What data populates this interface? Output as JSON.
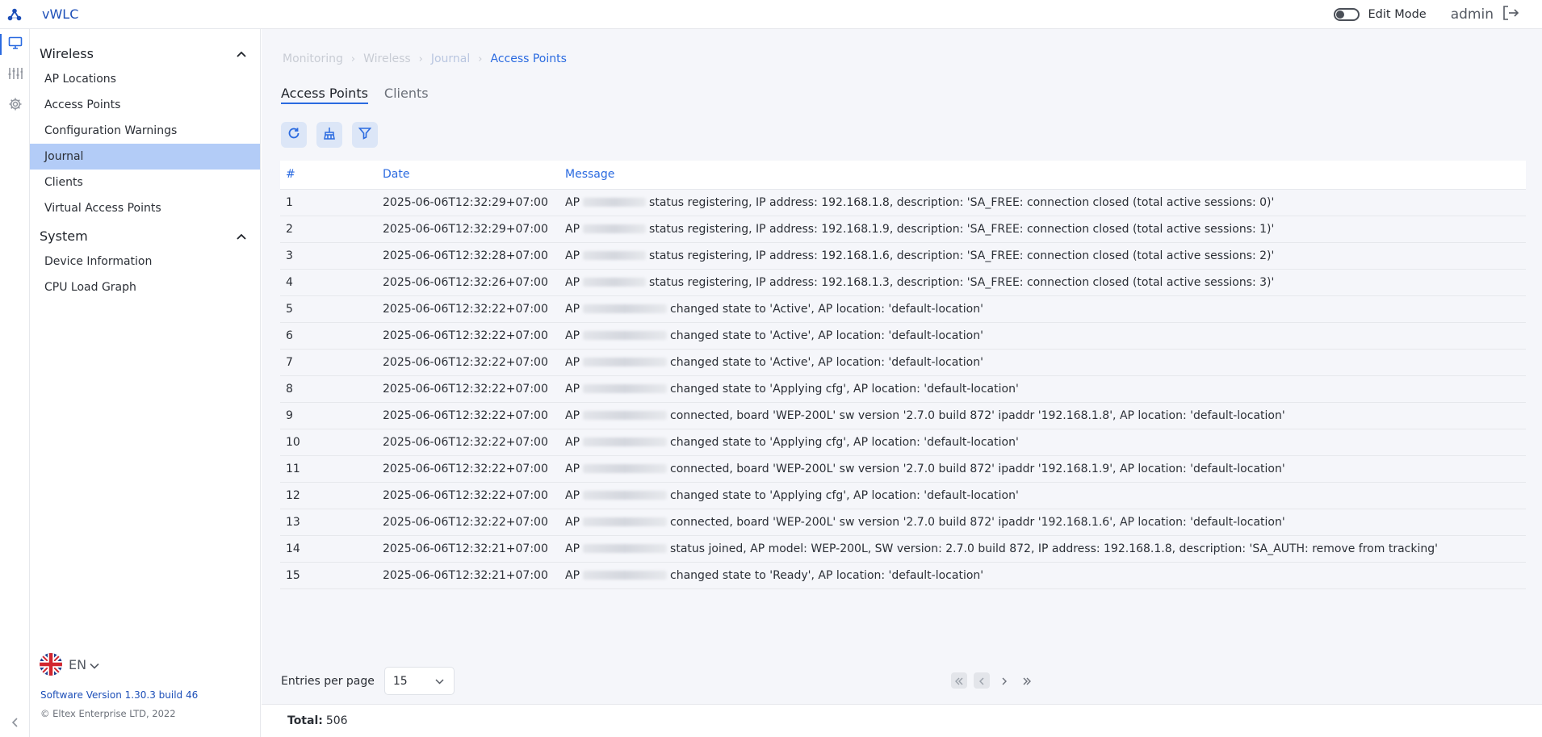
{
  "app": {
    "title": "vWLC"
  },
  "header": {
    "edit_mode_label": "Edit Mode",
    "edit_mode_on": false,
    "user": "admin"
  },
  "sidebar": {
    "sections": [
      {
        "title": "Wireless",
        "items": [
          "AP Locations",
          "Access Points",
          "Configuration Warnings",
          "Journal",
          "Clients",
          "Virtual Access Points"
        ]
      },
      {
        "title": "System",
        "items": [
          "Device Information",
          "CPU Load Graph"
        ]
      }
    ],
    "active_item": "Journal",
    "language": "EN",
    "version": "Software Version 1.30.3 build 46",
    "copyright": "© Eltex Enterprise LTD, 2022"
  },
  "breadcrumb": [
    "Monitoring",
    "Wireless",
    "Journal",
    "Access Points"
  ],
  "tabs": [
    {
      "label": "Access Points",
      "active": true
    },
    {
      "label": "Clients",
      "active": false
    }
  ],
  "table": {
    "headers": [
      "#",
      "Date",
      "Message"
    ],
    "rows": [
      {
        "num": "1",
        "date": "2025-06-06T12:32:29+07:00",
        "prefix": "AP",
        "message": "status registering, IP address: 192.168.1.8, description: 'SA_FREE: connection closed (total active sessions: 0)'"
      },
      {
        "num": "2",
        "date": "2025-06-06T12:32:29+07:00",
        "prefix": "AP",
        "message": "status registering, IP address: 192.168.1.9, description: 'SA_FREE: connection closed (total active sessions: 1)'"
      },
      {
        "num": "3",
        "date": "2025-06-06T12:32:28+07:00",
        "prefix": "AP",
        "message": "status registering, IP address: 192.168.1.6, description: 'SA_FREE: connection closed (total active sessions: 2)'"
      },
      {
        "num": "4",
        "date": "2025-06-06T12:32:26+07:00",
        "prefix": "AP",
        "message": "status registering, IP address: 192.168.1.3, description: 'SA_FREE: connection closed (total active sessions: 3)'"
      },
      {
        "num": "5",
        "date": "2025-06-06T12:32:22+07:00",
        "prefix": "AP",
        "message": "changed state to 'Active', AP location: 'default-location'"
      },
      {
        "num": "6",
        "date": "2025-06-06T12:32:22+07:00",
        "prefix": "AP",
        "message": "changed state to 'Active', AP location: 'default-location'"
      },
      {
        "num": "7",
        "date": "2025-06-06T12:32:22+07:00",
        "prefix": "AP",
        "message": "changed state to 'Active', AP location: 'default-location'"
      },
      {
        "num": "8",
        "date": "2025-06-06T12:32:22+07:00",
        "prefix": "AP",
        "message": "changed state to 'Applying cfg', AP location: 'default-location'"
      },
      {
        "num": "9",
        "date": "2025-06-06T12:32:22+07:00",
        "prefix": "AP",
        "message": "connected, board 'WEP-200L' sw version '2.7.0 build 872' ipaddr '192.168.1.8', AP location: 'default-location'"
      },
      {
        "num": "10",
        "date": "2025-06-06T12:32:22+07:00",
        "prefix": "AP",
        "message": "changed state to 'Applying cfg', AP location: 'default-location'"
      },
      {
        "num": "11",
        "date": "2025-06-06T12:32:22+07:00",
        "prefix": "AP",
        "message": "connected, board 'WEP-200L' sw version '2.7.0 build 872' ipaddr '192.168.1.9', AP location: 'default-location'"
      },
      {
        "num": "12",
        "date": "2025-06-06T12:32:22+07:00",
        "prefix": "AP",
        "message": "changed state to 'Applying cfg', AP location: 'default-location'"
      },
      {
        "num": "13",
        "date": "2025-06-06T12:32:22+07:00",
        "prefix": "AP",
        "message": "connected, board 'WEP-200L' sw version '2.7.0 build 872' ipaddr '192.168.1.6', AP location: 'default-location'"
      },
      {
        "num": "14",
        "date": "2025-06-06T12:32:21+07:00",
        "prefix": "AP",
        "message": "status joined, AP model: WEP-200L, SW version: 2.7.0 build 872, IP address: 192.168.1.8, description: 'SA_AUTH: remove from tracking'"
      },
      {
        "num": "15",
        "date": "2025-06-06T12:32:21+07:00",
        "prefix": "AP",
        "message": "changed state to 'Ready', AP location: 'default-location'"
      }
    ]
  },
  "pagination": {
    "entries_label": "Entries per page",
    "entries_value": "15"
  },
  "footer": {
    "total_label": "Total:",
    "total_value": "506"
  },
  "colors": {
    "accent": "#2a6ae0",
    "brand": "#1d4fb8",
    "active_nav": "#b3ccf7"
  },
  "icons": [
    "app-logo-icon",
    "logout-icon",
    "monitor-icon",
    "sliders-icon",
    "gear-icon",
    "chevron-up-icon",
    "chevron-down-icon",
    "chevron-left-icon",
    "refresh-icon",
    "broom-icon",
    "filter-icon",
    "uk-flag-icon"
  ]
}
